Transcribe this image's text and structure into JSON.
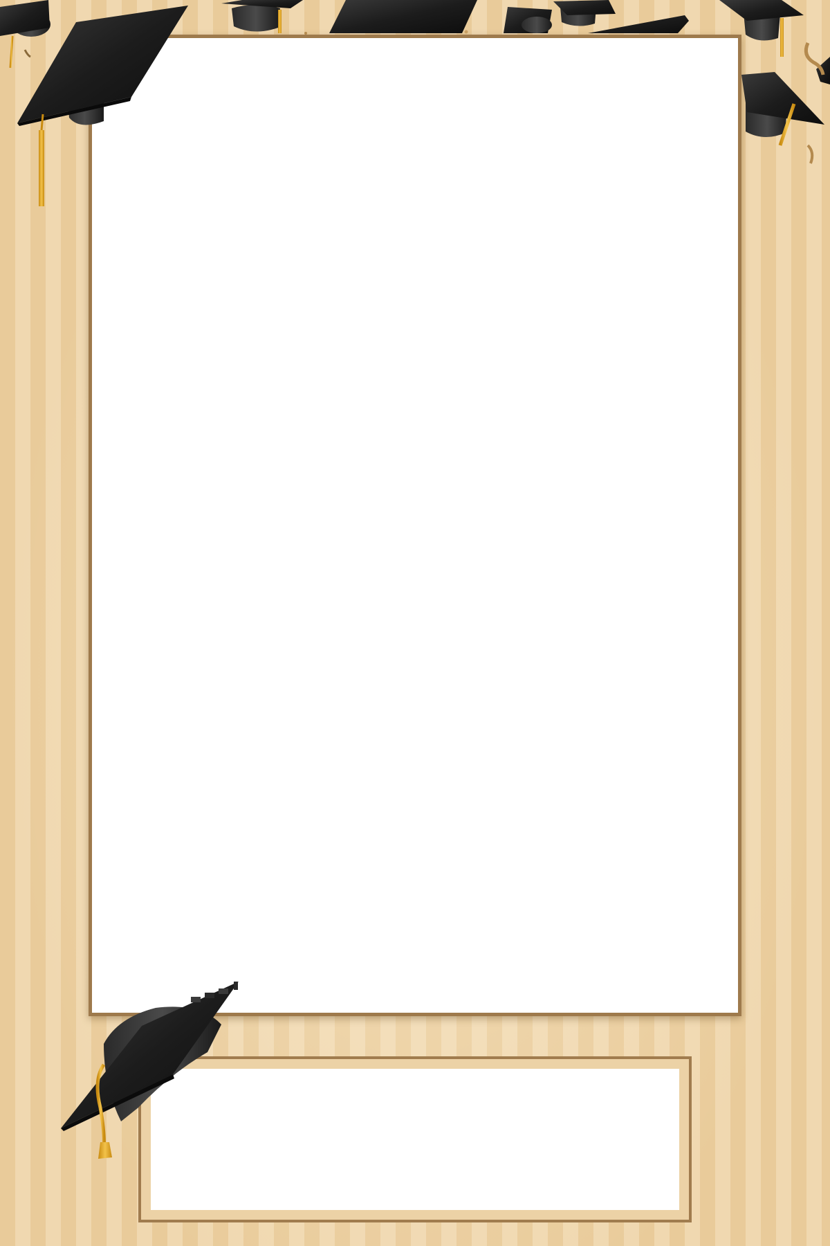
{
  "theme": {
    "background": "#ecd0a2",
    "stripe_light": "#f0d8b0",
    "stripe_dark": "#e9cb9a",
    "frame_border": "#9e7a4c",
    "cap_color": "#1f1f1f",
    "tassel_color": "#e0a81e",
    "confetti_color": "#b48a4e"
  },
  "photo_area": {
    "fill": "#ffffff"
  },
  "caption_area": {
    "fill": "#ffffff"
  },
  "decorations": {
    "top_caps": "graduation-cap-icon",
    "corner_cap": "graduation-cap-icon",
    "confetti": "confetti-icon"
  }
}
